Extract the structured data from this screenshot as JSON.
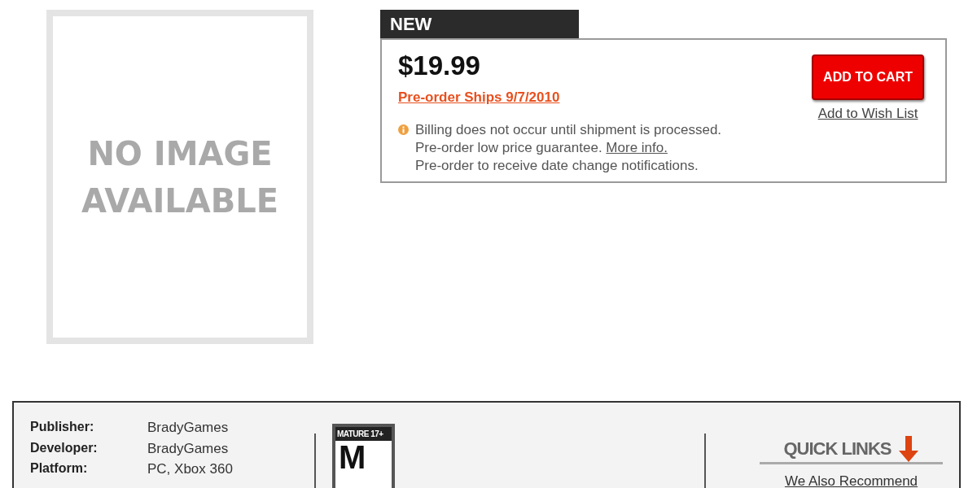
{
  "image_placeholder": {
    "lines": [
      "NO IMAGE",
      "AVAILABLE"
    ]
  },
  "offer": {
    "tab": "NEW",
    "price": "$19.99",
    "ship_link": "Pre-order Ships 9/7/2010",
    "add_to_cart": "ADD TO CART",
    "wish_list": "Add to Wish List",
    "notes": [
      "Billing does not occur until shipment is processed.",
      "Pre-order low price guarantee.",
      "Pre-order to receive date change notifications."
    ],
    "more_info": "More info."
  },
  "details": [
    {
      "label": "Publisher:",
      "value": "BradyGames"
    },
    {
      "label": "Developer:",
      "value": "BradyGames"
    },
    {
      "label": "Platform:",
      "value": "PC, Xbox 360"
    }
  ],
  "rating": {
    "label": "MATURE 17+",
    "letter": "M"
  },
  "quick_links": {
    "title": "QUICK LINKS",
    "first_item": "We Also Recommend"
  }
}
